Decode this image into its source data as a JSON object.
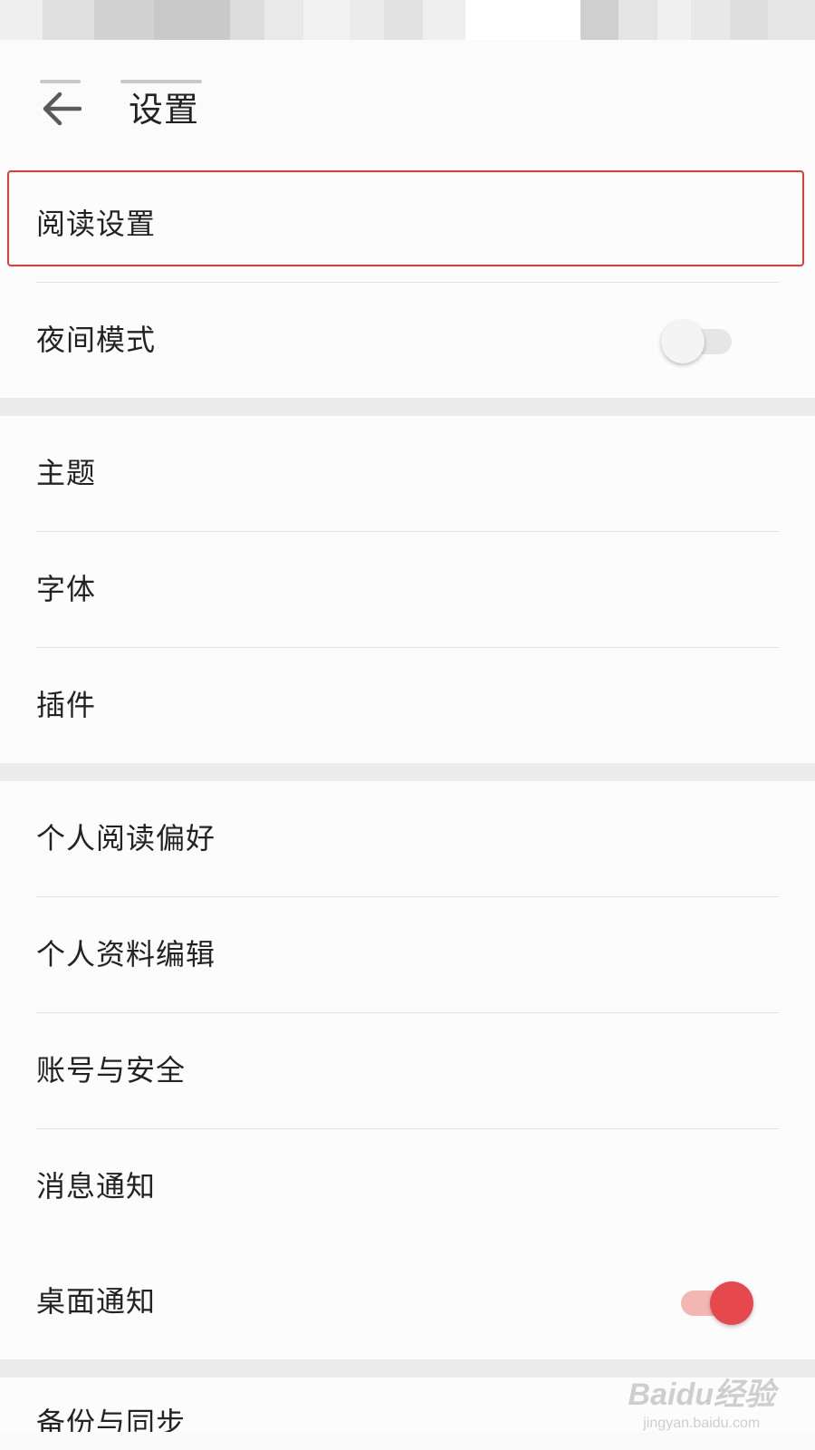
{
  "header": {
    "title": "设置",
    "back_icon": "arrow-left-icon"
  },
  "groups": [
    {
      "items": [
        {
          "label": "阅读设置",
          "highlighted": true
        },
        {
          "label": "夜间模式",
          "toggle": {
            "on": false
          }
        }
      ]
    },
    {
      "items": [
        {
          "label": "主题"
        },
        {
          "label": "字体"
        },
        {
          "label": "插件"
        }
      ]
    },
    {
      "items": [
        {
          "label": "个人阅读偏好"
        },
        {
          "label": "个人资料编辑"
        },
        {
          "label": "账号与安全"
        },
        {
          "label": "消息通知"
        },
        {
          "label": "桌面通知",
          "toggle": {
            "on": true
          }
        }
      ]
    },
    {
      "items": [
        {
          "label": "备份与同步",
          "partially_visible": true
        }
      ]
    }
  ],
  "colors": {
    "accent": "#e5484d",
    "highlight_border": "#e03c32"
  },
  "watermark": {
    "logo": "Baidu经验",
    "url": "jingyan.baidu.com"
  }
}
